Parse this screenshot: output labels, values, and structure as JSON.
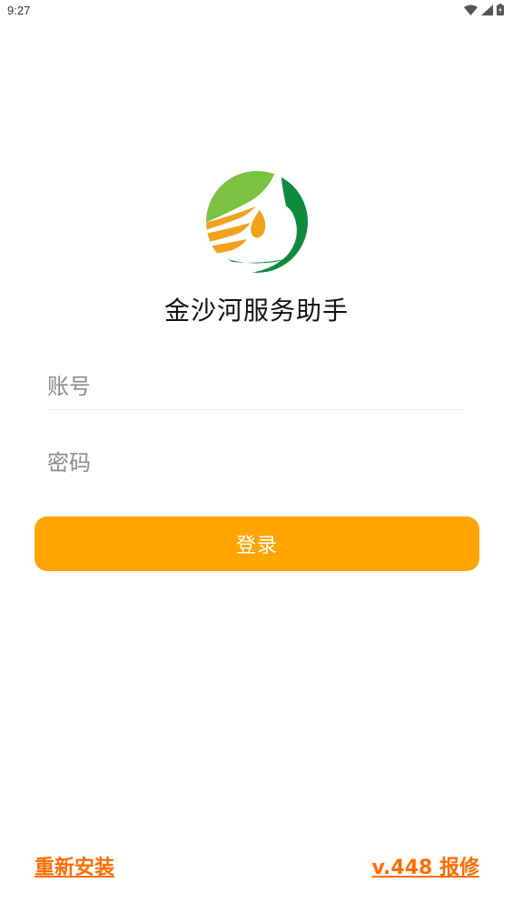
{
  "status_bar": {
    "time": "9:27",
    "icons": [
      "wifi-icon",
      "signal-icon",
      "battery-icon"
    ]
  },
  "app": {
    "logo_icon": "jinshahe-logo-icon",
    "title": "金沙河服务助手"
  },
  "form": {
    "account_placeholder": "账号",
    "account_value": "",
    "password_placeholder": "密码",
    "password_value": "",
    "login_label": "登录"
  },
  "footer": {
    "reinstall_label": "重新安装",
    "version_report_label": "v.448 报修"
  },
  "colors": {
    "accent": "#ffa400",
    "link": "#ff6d00",
    "logo_green_light": "#7cc142",
    "logo_green_dark": "#0e8a3e",
    "logo_orange": "#f0a21f"
  }
}
